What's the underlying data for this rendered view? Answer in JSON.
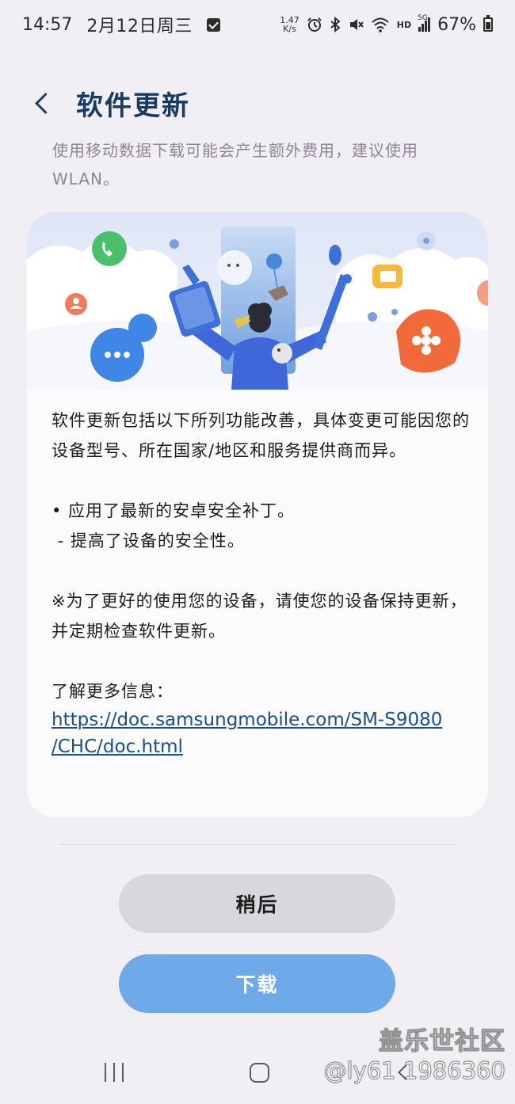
{
  "status_bar": {
    "time": "14:57",
    "date": "2月12日周三",
    "net_speed_value": "1.47",
    "net_speed_unit": "K/s",
    "network_label": "HD",
    "signal_label": "5G",
    "battery": "67%",
    "icons": [
      "checkbox-icon",
      "alarm-icon",
      "bluetooth-icon",
      "mute-icon",
      "wifi-icon",
      "signal-icon",
      "battery-icon"
    ]
  },
  "header": {
    "title": "软件更新",
    "back_icon": "back-chevron-icon"
  },
  "notice": "使用移动数据下载可能会产生额外费用，建议使用WLAN。",
  "card": {
    "intro": "软件更新包括以下所列功能改善，具体变更可能因您的设备型号、所在国家/地区和服务提供商而异。",
    "bullet": "• 应用了最新的安卓安全补丁。",
    "sub_bullet": " - 提高了设备的安全性。",
    "note": "※为了更好的使用您的设备，请使您的设备保持更新，并定期检查软件更新。",
    "more_info_label": "了解更多信息：",
    "link_line1": "https://doc.samsungmobile.com/SM-S9080",
    "link_line2": "/CHC/doc.html"
  },
  "buttons": {
    "later": "稍后",
    "download": "下载"
  },
  "nav_bar": {
    "icons": [
      "recent-apps-icon",
      "home-icon",
      "back-icon"
    ]
  },
  "watermark": {
    "line1": "盖乐世社区",
    "line2": "@ly61 1986360"
  },
  "colors": {
    "background": "#f1eef4",
    "title": "#173b63",
    "notice_text": "#8f8698",
    "link": "#1a4f8a",
    "later_button": "#d9d6dc",
    "download_button": "#6ea9e9",
    "card": "#fbfbfd"
  }
}
